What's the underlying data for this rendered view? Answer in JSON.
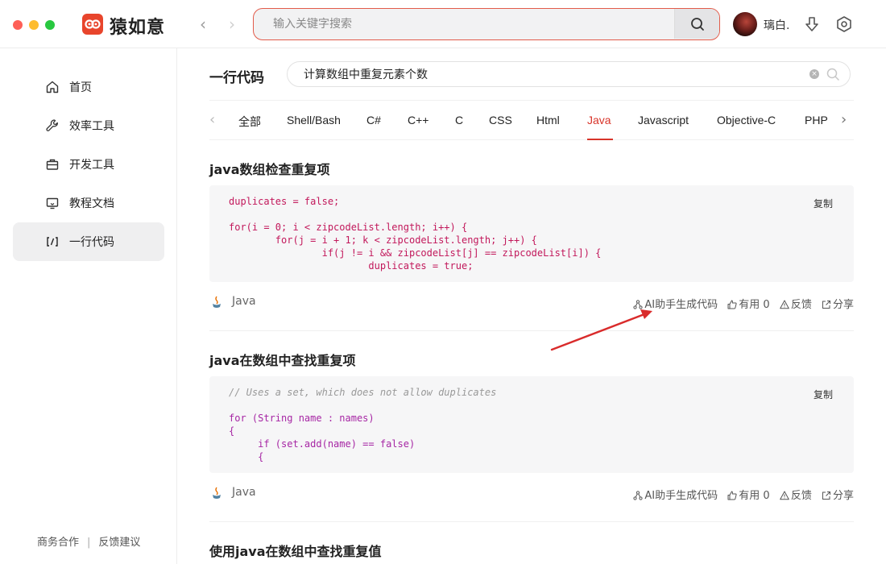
{
  "window": {
    "app_name": "猿如意",
    "logo_glyph": "ஃ",
    "search_placeholder": "输入关键字搜索",
    "user_name": "璃白.",
    "nav_back": "‹",
    "nav_forward": "›"
  },
  "sidebar": {
    "items": [
      {
        "label": "首页",
        "icon": "home-icon"
      },
      {
        "label": "效率工具",
        "icon": "wrench-icon"
      },
      {
        "label": "开发工具",
        "icon": "toolbox-icon"
      },
      {
        "label": "教程文档",
        "icon": "monitor-icon"
      },
      {
        "label": "一行代码",
        "icon": "code-bracket-icon",
        "active": true
      }
    ],
    "footer": {
      "business": "商务合作",
      "separator": "|",
      "feedback": "反馈建议"
    }
  },
  "main": {
    "title": "一行代码",
    "search_value": "计算数组中重复元素个数",
    "clear_glyph": "×",
    "tabs": [
      "全部",
      "Shell/Bash",
      "C#",
      "C++",
      "C",
      "CSS",
      "Html",
      "Java",
      "Javascript",
      "Objective-C",
      "PHP"
    ],
    "active_tab": "Java",
    "tab_prev": "‹",
    "tab_next": "›"
  },
  "snippets": [
    {
      "title": "java数组检查重复项",
      "language": "Java",
      "copy_label": "复制",
      "code_lines": [
        "duplicates = false;",
        "",
        "for(i = 0; i < zipcodeList.length; i++) {",
        "        for(j = i + 1; k < zipcodeList.length; j++) {",
        "                if(j != i && zipcodeList[j] == zipcodeList[i]) {",
        "                        duplicates = true;"
      ],
      "actions": {
        "ai": "AI助手生成代码",
        "useful": "有用 0",
        "feedback": "反馈",
        "share": "分享"
      }
    },
    {
      "title": "java在数组中查找重复项",
      "language": "Java",
      "copy_label": "复制",
      "code_lines": [
        "// Uses a set, which does not allow duplicates",
        "",
        "for (String name : names)",
        "{",
        "     if (set.add(name) == false)",
        "     {"
      ],
      "actions": {
        "ai": "AI助手生成代码",
        "useful": "有用 0",
        "feedback": "反馈",
        "share": "分享"
      }
    },
    {
      "title": "使用java在数组中查找重复值"
    }
  ],
  "colors": {
    "accent": "#d8342a",
    "annotation_arrow": "#d92b2b"
  }
}
